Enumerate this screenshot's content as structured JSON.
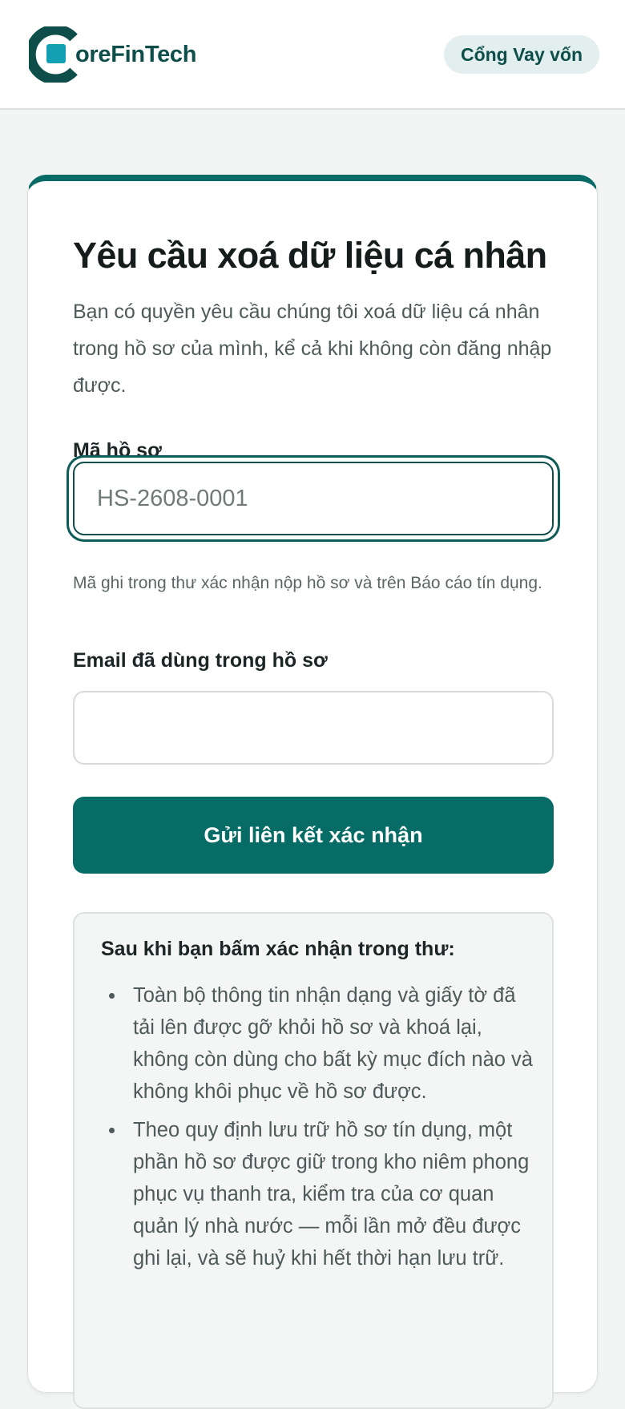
{
  "header": {
    "logo_text": "oreFinTech",
    "logo_icon": "corefintech-logo-icon",
    "portal_label": "Cổng Vay vốn"
  },
  "form": {
    "title": "Yêu cầu xoá dữ liệu cá nhân",
    "subtitle": "Bạn có quyền yêu cầu chúng tôi xoá dữ liệu cá nhân trong hồ sơ của mình, kể cả khi không còn đăng nhập được.",
    "case_id": {
      "label": "Mã hồ sơ",
      "placeholder": "HS-2608-0001",
      "value": "",
      "hint": "Mã ghi trong thư xác nhận nộp hồ sơ và trên Báo cáo tín dụng."
    },
    "email": {
      "label": "Email đã dùng trong hồ sơ",
      "placeholder": "",
      "value": ""
    },
    "submit_label": "Gửi liên kết xác nhận"
  },
  "info": {
    "title": "Sau khi bạn bấm xác nhận trong thư:",
    "items": [
      "Toàn bộ thông tin nhận dạng và giấy tờ đã tải lên được gỡ khỏi hồ sơ và khoá lại, không còn dùng cho bất kỳ mục đích nào và không khôi phục về hồ sơ được.",
      "Theo quy định lưu trữ hồ sơ tín dụng, một phần hồ sơ được giữ trong kho niêm phong phục vụ thanh tra, kiểm tra của cơ quan quản lý nhà nước — mỗi lần mở đều được ghi lại, và sẽ huỷ khi hết thời hạn lưu trữ."
    ]
  },
  "colors": {
    "brand": "#0a6b66",
    "brand_dark": "#0d4d4a",
    "accent_logo": "#13a0b5",
    "background": "#f3f5f4"
  }
}
